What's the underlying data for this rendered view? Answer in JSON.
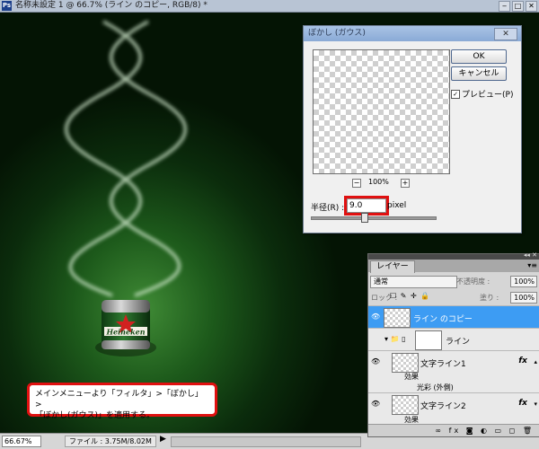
{
  "window": {
    "title": "名称未設定 1 @ 66.7% (ライン のコピー, RGB/8) *",
    "ps_icon": "Ps",
    "btn_min": "‒",
    "btn_max": "□",
    "btn_close": "✕"
  },
  "statusbar": {
    "zoom": "66.67%",
    "file_info": "ファイル : 3.75M/8.02M",
    "arrow": "▶"
  },
  "gaussian_dialog": {
    "title": "ぼかし (ガウス)",
    "close": "✕",
    "ok_label": "OK",
    "cancel_label": "キャンセル",
    "preview_checked": "✓",
    "preview_label": "プレビュー(P)",
    "zoom_minus": "−",
    "zoom_plus": "+",
    "zoom": "100%",
    "radius_label": "半径(R) :",
    "radius_value": "9.0",
    "radius_unit": "pixel",
    "radius_slider_fraction": 0.42
  },
  "layers_panel": {
    "collapse": "◂◂ ✕",
    "tab_label": "レイヤー",
    "menu_icon": "▾≡",
    "blend_mode": "通常",
    "opacity_label": "不透明度 :",
    "opacity_value": "100%",
    "lock_label": "ロック :",
    "lock_icons": "☐ ✎ ✛ 🔒",
    "fill_label": "塗り :",
    "fill_value": "100%",
    "layers": [
      {
        "name": "ライン のコピー",
        "selected": true
      },
      {
        "name": "ライン"
      },
      {
        "name": "文字ライン1",
        "effect": "効果",
        "sub_effect": "光彩 (外側)",
        "fx": "fx"
      },
      {
        "name": "文字ライン2",
        "effect": "効果",
        "sub_effect": "光彩 (外側)",
        "fx": "fx"
      }
    ],
    "eye": "👁",
    "twirl": "▾",
    "folder": "▾ 📁 ▯",
    "tri": "▴",
    "tri_down": "▾",
    "bottom_icons": "∞ fx ◙ ◐ ▭ ◻ 🗑"
  },
  "annotation": {
    "line1": "メインメニューより「フィルタ」>「ぼかし」>",
    "line2": "「ぼかし(ガウス)」を適用する。"
  },
  "can_label": "Heineken",
  "colors": {
    "highlight_red": "#e01010",
    "selection_blue": "#3d9cf3",
    "canvas_green": "#1d5a1b"
  }
}
